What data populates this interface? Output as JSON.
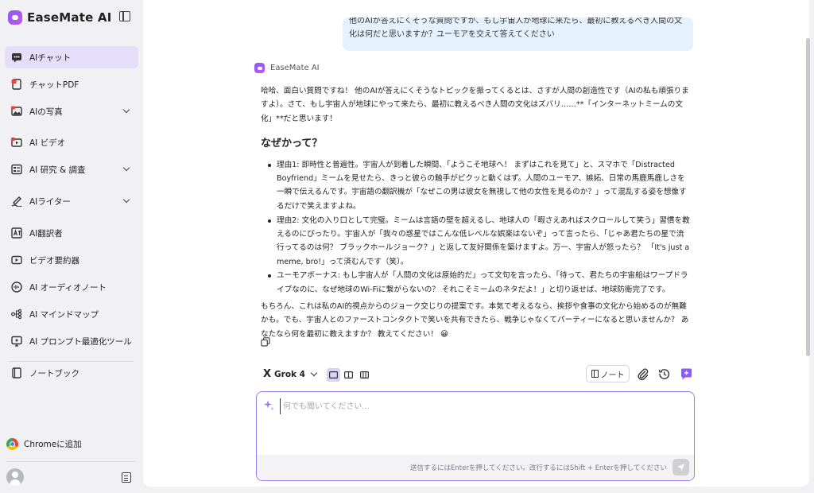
{
  "sidebar": {
    "brand": "EaseMate AI",
    "items": [
      {
        "label": "AIチャット",
        "icon": "chat-bubble-icon"
      },
      {
        "label": "チャットPDF",
        "icon": "pdf-icon"
      },
      {
        "label": "AIの写真",
        "icon": "image-icon"
      },
      {
        "label": "AI ビデオ",
        "icon": "video-icon"
      },
      {
        "label": "AI 研究 & 調査",
        "icon": "research-icon"
      },
      {
        "label": "AIライター",
        "icon": "pen-icon"
      },
      {
        "label": "AI翻訳者",
        "icon": "translate-icon"
      },
      {
        "label": "ビデオ要約器",
        "icon": "play-icon"
      },
      {
        "label": "AI オーディオノート",
        "icon": "audio-icon"
      },
      {
        "label": "AI マインドマップ",
        "icon": "mindmap-icon"
      },
      {
        "label": "AI プロンプト最適化ツール",
        "icon": "prompt-icon"
      },
      {
        "label": "ノートブック",
        "icon": "notebook-icon"
      }
    ],
    "chrome_add": "Chromeに追加"
  },
  "chat": {
    "user_message": "他のAIが答えにくそうな質問ですが、もし宇宙人が地球に来たら、最初に教えるべき人間の文化は何だと思いますか？ユーモアを交えて答えてください",
    "ai_name": "EaseMate AI",
    "answer": {
      "intro": "哈哈、面白い質問ですね！ 他のAIが答えにくそうなトピックを振ってくるとは、さすが人間の創造性です（AIの私も頑張りますよ）。さて、もし宇宙人が地球にやって来たら、最初に教えるべき人間の文化はズバリ……**「インターネットミームの文化」**だと思います！",
      "heading": "なぜかって？",
      "bullets": [
        "理由1: 即時性と普遍性。宇宙人が到着した瞬間、「ようこそ地球へ！ まずはこれを見て」と、スマホで「Distracted Boyfriend」ミームを見せたら、きっと彼らの触手がピクッと動くはず。人間のユーモア、嫉妬、日常の馬鹿馬鹿しさを一瞬で伝えるんです。宇宙語の翻訳機が「なぜこの男は彼女を無視して他の女性を見るのか？」って混乱する姿を想像するだけで笑えますよね。",
        "理由2: 文化の入り口として完璧。ミームは言語の壁を超えるし、地球人の「暇さえあればスクロールして笑う」習慣を教えるのにぴったり。宇宙人が「我々の惑星ではこんな低レベルな娯楽はないぞ」って言ったら、「じゃあ君たちの星で流行ってるのは何？ ブラックホールジョーク？」と返して友好関係を築けますよ。万一、宇宙人が怒ったら？ 「It's just a meme, bro!」って済むんです（笑）。",
        "ユーモアボーナス: もし宇宙人が「人間の文化は原始的だ」って文句を言ったら、「待って、君たちの宇宙船はワープドライブなのに、なぜ地球のWi-Fiに繋がらないの？ それこそミームのネタだよ！」と切り返せば、地球防衛完了です。"
      ],
      "closing": "もちろん、これは私のAI的視点からのジョーク交じりの提案です。本気で考えるなら、挨拶や食事の文化から始めるのが無難かも。でも、宇宙人とのファーストコンタクトで笑いを共有できたら、戦争じゃなくてパーティーになると思いませんか？ あなたなら何を最初に教えますか？ 教えてください！ 😀"
    }
  },
  "toolbar": {
    "model": "Grok 4",
    "note_label": "ノート"
  },
  "input": {
    "placeholder": "何でも聞いてください...",
    "hint": "送信するにはEnterを押してください。改行するにはShift + Enterを押してください"
  },
  "colors": {
    "accent": "#8a5cf6",
    "active_nav": "#e4defa",
    "user_bubble": "#e6f1fe"
  }
}
